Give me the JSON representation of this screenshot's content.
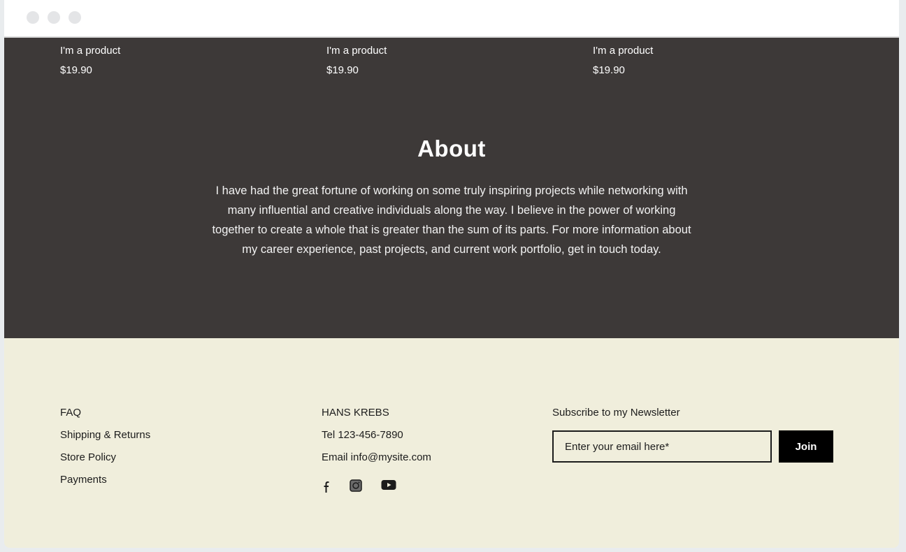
{
  "products": [
    {
      "name": "I'm a product",
      "price": "$19.90"
    },
    {
      "name": "I'm a product",
      "price": "$19.90"
    },
    {
      "name": "I'm a product",
      "price": "$19.90"
    }
  ],
  "about": {
    "title": "About",
    "text": "I have had the great fortune of working on some truly inspiring projects while networking with many influential and creative individuals along the way. I believe in the power of working together to create a whole that is greater than the sum of its parts. For more information about my career experience, past projects, and current work portfolio, get in touch today."
  },
  "footer": {
    "links": [
      "FAQ",
      "Shipping & Returns",
      "Store Policy",
      "Payments"
    ],
    "name": "HANS KREBS",
    "tel": "Tel 123-456-7890",
    "email": "Email info@mysite.com",
    "social": [
      "facebook-icon",
      "instagram-icon",
      "youtube-icon"
    ],
    "newsletter": {
      "label": "Subscribe to my Newsletter",
      "placeholder": "Enter your email here*",
      "button": "Join"
    }
  },
  "colors": {
    "dark_section": "#3d3938",
    "footer_bg": "#f0eedc",
    "button": "#000000"
  }
}
